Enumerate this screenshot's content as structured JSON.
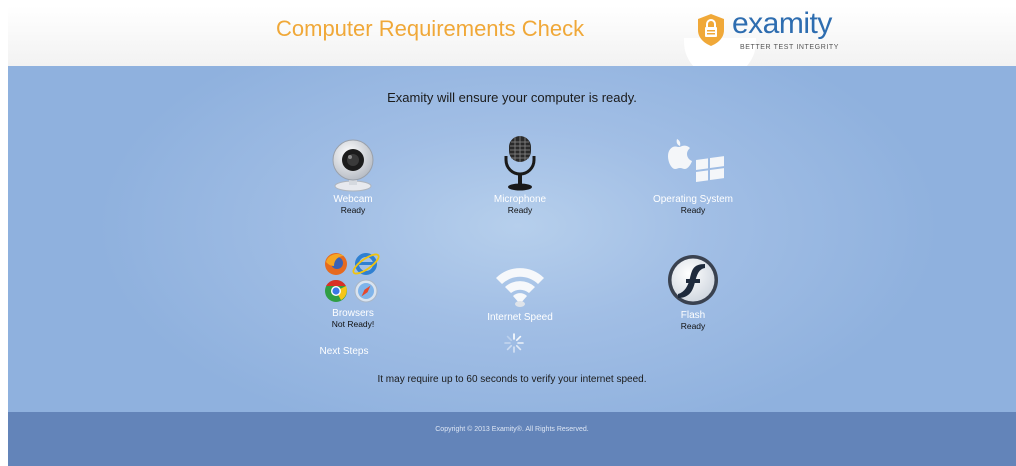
{
  "header": {
    "title": "Computer Requirements Check",
    "logo": {
      "word": "examity",
      "tagline": "BETTER TEST INTEGRITY",
      "colors": {
        "word": "#2e6db0",
        "shield": "#f0a838"
      }
    }
  },
  "intro": "Examity will ensure your computer is ready.",
  "checks": [
    {
      "name": "Webcam",
      "status": "Ready",
      "icon": "webcam-icon"
    },
    {
      "name": "Microphone",
      "status": "Ready",
      "icon": "microphone-icon"
    },
    {
      "name": "Operating System",
      "status": "Ready",
      "icon": "os-icon"
    },
    {
      "name": "Browsers",
      "status": "Not Ready!",
      "icon": "browsers-icon"
    },
    {
      "name": "Internet Speed",
      "status": "",
      "icon": "wifi-icon"
    },
    {
      "name": "Flash",
      "status": "Ready",
      "icon": "flash-icon"
    }
  ],
  "next_steps": "Next Steps",
  "note": "It may require up to 60 seconds to verify your internet speed.",
  "footer": {
    "copyright": "Copyright © 2013 Examity®. All Rights Reserved."
  },
  "colors": {
    "accent": "#f0a838",
    "background": "#a1bee5",
    "footer": "#6384b9"
  }
}
